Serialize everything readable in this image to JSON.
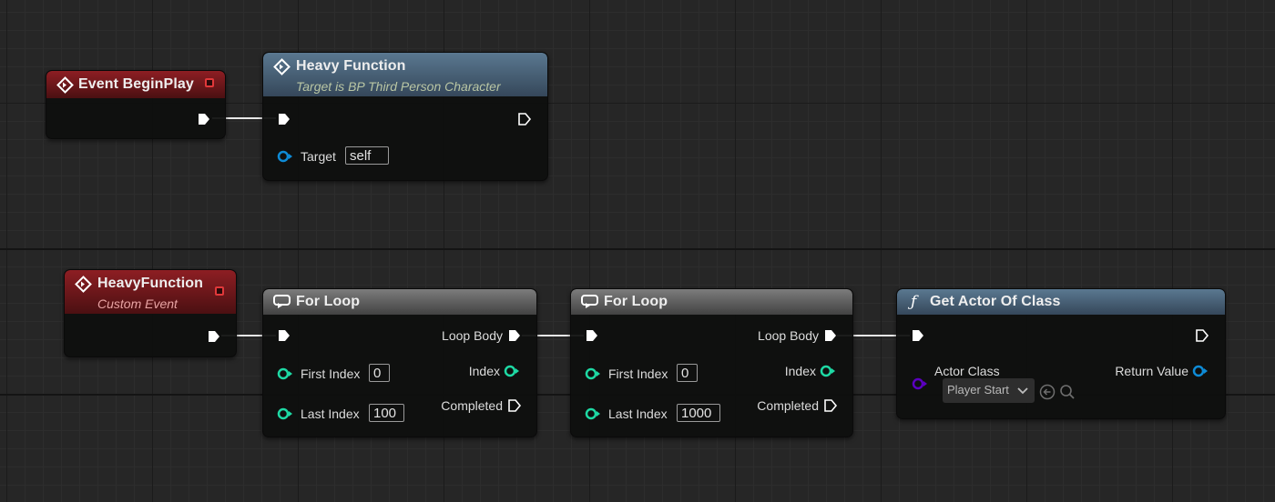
{
  "nodes": {
    "event_beginplay": {
      "title": "Event BeginPlay"
    },
    "heavy_function_call": {
      "title": "Heavy Function",
      "subtitle": "Target is BP Third Person Character",
      "target_label": "Target",
      "target_value": "self"
    },
    "heavy_function_event": {
      "title": "HeavyFunction",
      "subtitle": "Custom Event"
    },
    "for_loop_1": {
      "title": "For Loop",
      "loop_body_label": "Loop Body",
      "first_index_label": "First Index",
      "first_index_value": "0",
      "index_label": "Index",
      "last_index_label": "Last Index",
      "last_index_value": "100",
      "completed_label": "Completed"
    },
    "for_loop_2": {
      "title": "For Loop",
      "loop_body_label": "Loop Body",
      "first_index_label": "First Index",
      "first_index_value": "0",
      "index_label": "Index",
      "last_index_label": "Last Index",
      "last_index_value": "1000",
      "completed_label": "Completed"
    },
    "get_actor_of_class": {
      "title": "Get Actor Of Class",
      "actor_class_label": "Actor Class",
      "actor_class_value": "Player Start",
      "return_value_label": "Return Value"
    }
  },
  "icons": {
    "event": "event-diamond-icon",
    "loop": "loop-icon",
    "function": "function-f-icon",
    "browse": "browse-arrow-icon",
    "search": "search-icon",
    "dropdown": "chevron-down-icon"
  },
  "colors": {
    "event_header": "#8d1e23",
    "function_header": "#5a7890",
    "macro_header": "#7c7c7c",
    "exec_pin": "#ffffff",
    "int_pin": "#1ed9a4",
    "object_pin": "#0e8bd6",
    "class_pin": "#5b00c0",
    "delegate_square": "#e0383a",
    "heavy_function_subtitle": "#b9c6a4",
    "custom_event_subtitle": "#e8a3a3"
  }
}
